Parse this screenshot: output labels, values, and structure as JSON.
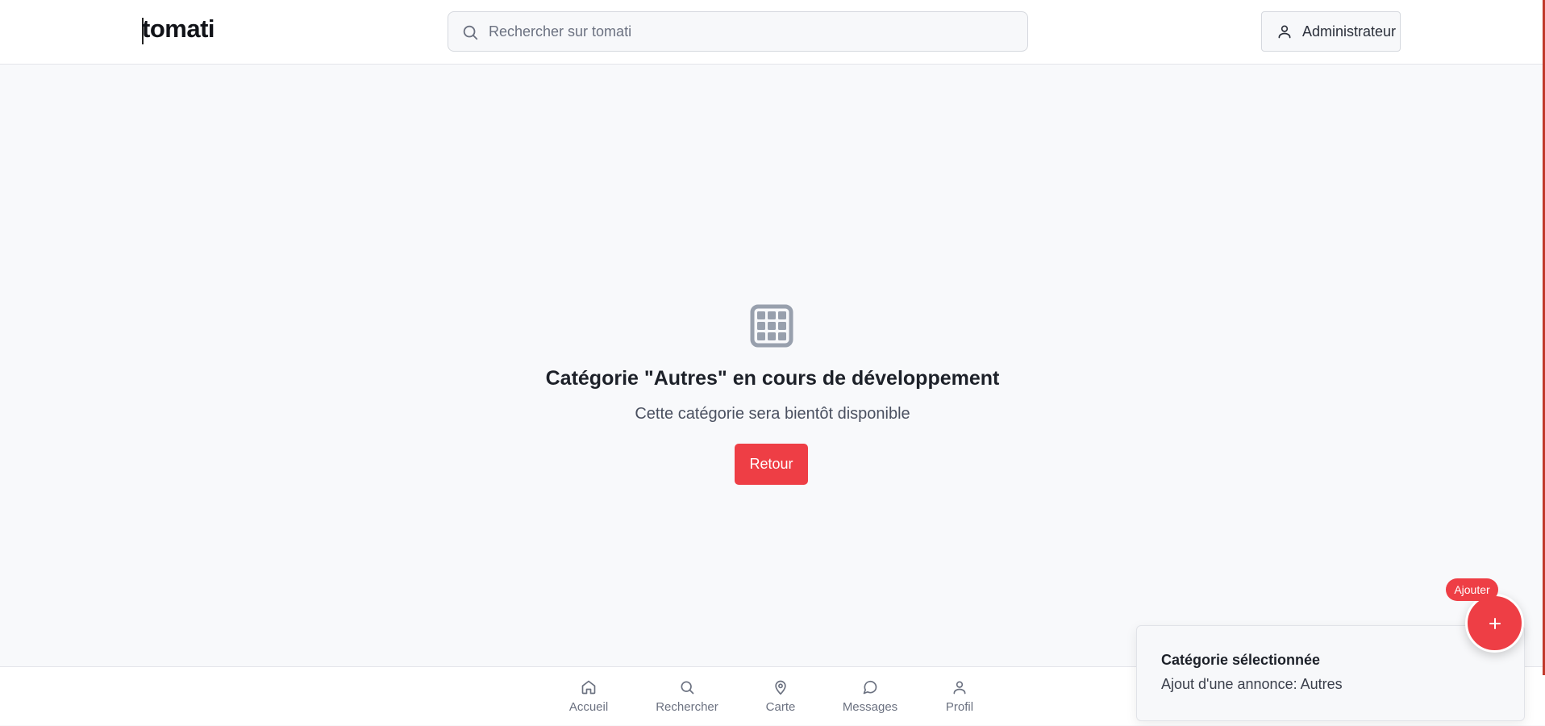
{
  "header": {
    "logo": "tomati",
    "search_placeholder": "Rechercher sur tomati",
    "search_value": "",
    "user_button_label": "Administrateur"
  },
  "main": {
    "icon": "grid-icon",
    "title": "Catégorie \"Autres\" en cours de développement",
    "subtitle": "Cette catégorie sera bientôt disponible",
    "back_button": "Retour"
  },
  "bottom_nav": {
    "items": [
      {
        "label": "Accueil",
        "icon": "home-icon"
      },
      {
        "label": "Rechercher",
        "icon": "search-icon"
      },
      {
        "label": "Carte",
        "icon": "map-pin-icon"
      },
      {
        "label": "Messages",
        "icon": "message-icon"
      },
      {
        "label": "Profil",
        "icon": "user-icon"
      }
    ]
  },
  "toast": {
    "title": "Catégorie sélectionnée",
    "description": "Ajout d'une annonce: Autres"
  },
  "fab": {
    "badge_label": "Ajouter",
    "icon": "plus-icon"
  },
  "colors": {
    "accent": "#ee3e45",
    "background": "#f8f9fb",
    "text": "#1d2129",
    "muted": "#6b7180"
  }
}
